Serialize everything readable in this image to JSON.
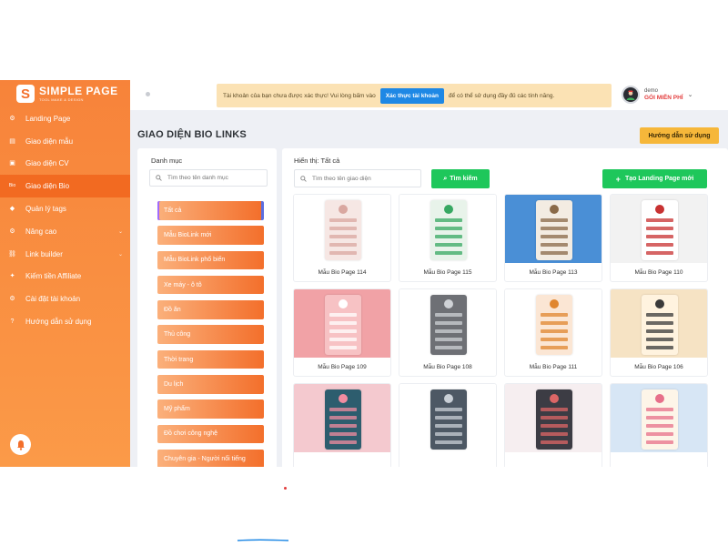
{
  "brand": {
    "name": "SIMPLE PAGE",
    "tagline": "TOOL MAKE & DESIGN"
  },
  "sidebar": {
    "items": [
      {
        "label": "Landing Page",
        "icon": "gear-icon",
        "active": false
      },
      {
        "label": "Giao diện mẫu",
        "icon": "document-icon",
        "active": false
      },
      {
        "label": "Giao diện CV",
        "icon": "id-card-icon",
        "active": false
      },
      {
        "label": "Giao diện Bio",
        "icon": "bio-icon",
        "active": true
      },
      {
        "label": "Quản lý tags",
        "icon": "tag-icon",
        "active": false
      },
      {
        "label": "Nâng cao",
        "icon": "cog-icon",
        "active": false,
        "has_submenu": true
      },
      {
        "label": "Link builder",
        "icon": "link-icon",
        "active": false,
        "has_submenu": true
      },
      {
        "label": "Kiếm tiền Affiliate",
        "icon": "affiliate-icon",
        "active": false
      },
      {
        "label": "Cài đặt tài khoản",
        "icon": "settings-icon",
        "active": false
      },
      {
        "label": "Hướng dẫn sử dụng",
        "icon": "help-icon",
        "active": false
      }
    ]
  },
  "alert": {
    "before": "Tài khoản của bạn chưa được xác thực! Vui lòng bấm vào",
    "button": "Xác thực tài khoản",
    "after": "để có thể sử dụng đầy đủ các tính năng."
  },
  "user": {
    "name": "demo",
    "plan": "GÓI MIỄN PHÍ"
  },
  "page": {
    "title": "GIAO DIỆN BIO LINKS",
    "guide_button": "Hướng dẫn sử dụng"
  },
  "categories": {
    "title": "Danh mục",
    "search_placeholder": "Tìm theo tên danh mục",
    "items": [
      "Tất cả",
      "Mẫu BioLink mới",
      "Mẫu BioLink phổ biến",
      "Xe máy - ô tô",
      "Đồ ăn",
      "Thủ công",
      "Thời trang",
      "Du lịch",
      "Mỹ phẩm",
      "Đồ chơi công nghệ",
      "Chuyên gia - Người nổi tiếng"
    ]
  },
  "grid": {
    "filter_label": "Hiển thị: Tất cả",
    "search_placeholder": "Tìm theo tên giao diện",
    "search_button": "Tìm kiếm",
    "create_button": "Tạo Landing Page mới",
    "cards": [
      {
        "caption": "Mẫu Bio Page 114",
        "bg": "#ffffff",
        "phone": "#f6e7e4",
        "accent": "#d9a7a0"
      },
      {
        "caption": "Mẫu Bio Page 115",
        "bg": "#ffffff",
        "phone": "#e8f3ea",
        "accent": "#37a862"
      },
      {
        "caption": "Mẫu Bio Page 113",
        "bg": "#4a8fd6",
        "phone": "#f3ece2",
        "accent": "#8a6a48"
      },
      {
        "caption": "Mẫu Bio Page 110",
        "bg": "#f2f2f2",
        "phone": "#ffffff",
        "accent": "#c83232"
      },
      {
        "caption": "Mẫu Bio Page 109",
        "bg": "#f1a2a6",
        "phone": "#f7c2c4",
        "accent": "#ffffff"
      },
      {
        "caption": "Mẫu Bio Page 108",
        "bg": "#ffffff",
        "phone": "#6e7075",
        "accent": "#cfd2d6"
      },
      {
        "caption": "Mẫu Bio Page 111",
        "bg": "#ffffff",
        "phone": "#fbe6d4",
        "accent": "#e0862f"
      },
      {
        "caption": "Mẫu Bio Page 106",
        "bg": "#f6e3c4",
        "phone": "#fff3df",
        "accent": "#3a3a3a"
      },
      {
        "caption": "",
        "bg": "#f4c9cf",
        "phone": "#2d5d6e",
        "accent": "#f28ca0"
      },
      {
        "caption": "",
        "bg": "#ffffff",
        "phone": "#4d5864",
        "accent": "#c9cfd6"
      },
      {
        "caption": "",
        "bg": "#f6eef0",
        "phone": "#3c3c44",
        "accent": "#d66"
      },
      {
        "caption": "",
        "bg": "#d7e6f5",
        "phone": "#fdf5e8",
        "accent": "#e76f8a"
      }
    ]
  },
  "colors": {
    "primary": "#f36f2b",
    "green": "#1ec75b",
    "blue": "#1e88e5",
    "warning": "#f6b73a"
  }
}
